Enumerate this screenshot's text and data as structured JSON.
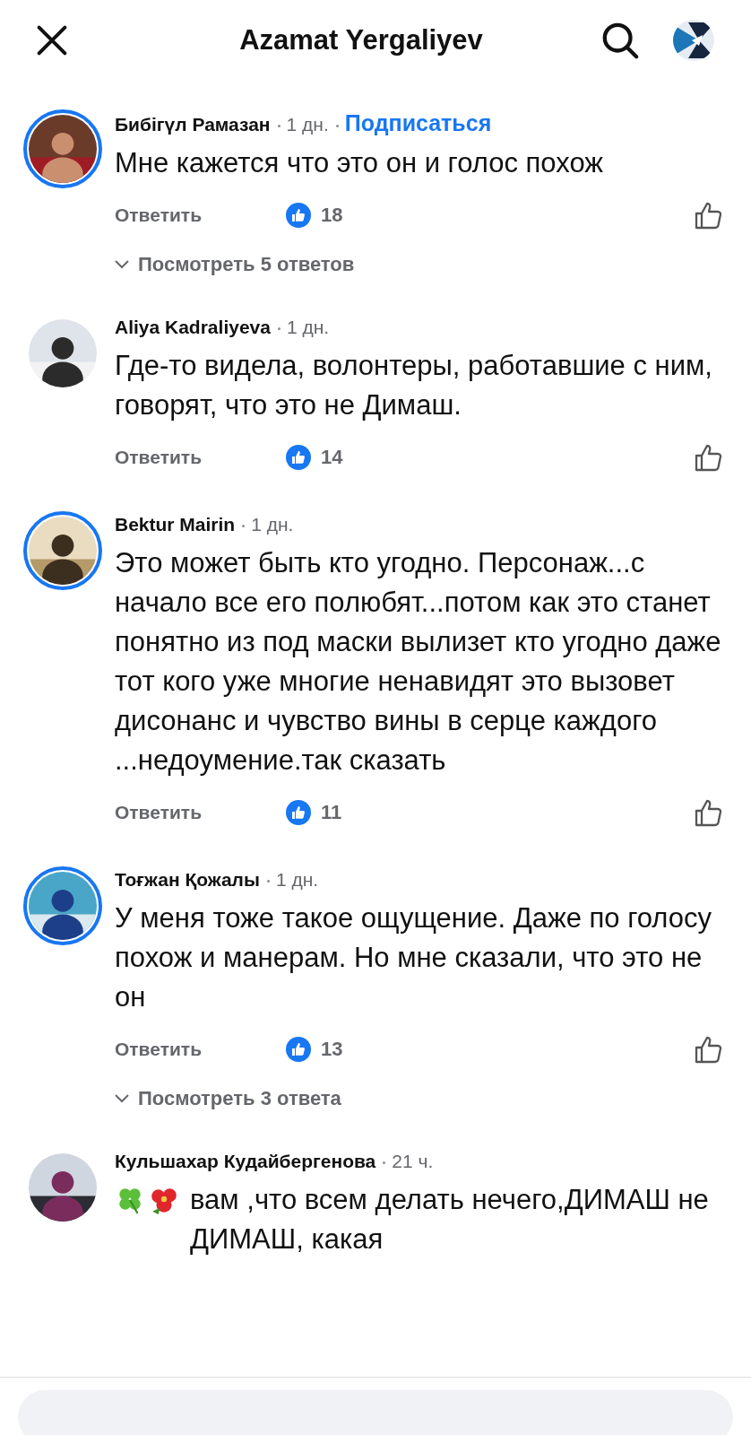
{
  "header": {
    "title": "Azamat Yergaliyev"
  },
  "comments": [
    {
      "author": "Бибiгүл Рамазан",
      "time": "1 дн.",
      "follow": "Подписаться",
      "story_ring": true,
      "emojis": false,
      "text": "Мне кажется что это он и голос похож",
      "reply": "Ответить",
      "likes": "18",
      "replies": "Посмотреть 5 ответов"
    },
    {
      "author": "Aliya Kadraliyeva",
      "time": "1 дн.",
      "story_ring": false,
      "emojis": false,
      "text": "Где-то видела, волонтеры, работавшие с ним, говорят, что это не Димаш.",
      "reply": "Ответить",
      "likes": "14"
    },
    {
      "author": "Bektur Mairin",
      "time": "1 дн.",
      "story_ring": true,
      "emojis": false,
      "text": "Это может быть кто угодно. Персонаж...с начало  все его полюбят...потом как это станет понятно из под маски  вылизет кто угодно даже тот кого уже многие ненавидят это вызовет дисонанс и чувство вины  в серце каждого ...недоумение.так сказать",
      "reply": "Ответить",
      "likes": "11"
    },
    {
      "author": "Тоғжан Қожалы",
      "time": "1 дн.",
      "story_ring": true,
      "emojis": false,
      "text": "У меня тоже такое ощущение. Даже по голосу похож и манерам. Но мне сказали, что это не он",
      "reply": "Ответить",
      "likes": "13",
      "replies": "Посмотреть 3 ответа"
    },
    {
      "author": "Кульшахар Кудайбергенова",
      "time": "21 ч.",
      "story_ring": false,
      "emojis": true,
      "text": "вам ,что всем делать нечего,ДИМАШ не ДИМАШ, какая"
    }
  ]
}
